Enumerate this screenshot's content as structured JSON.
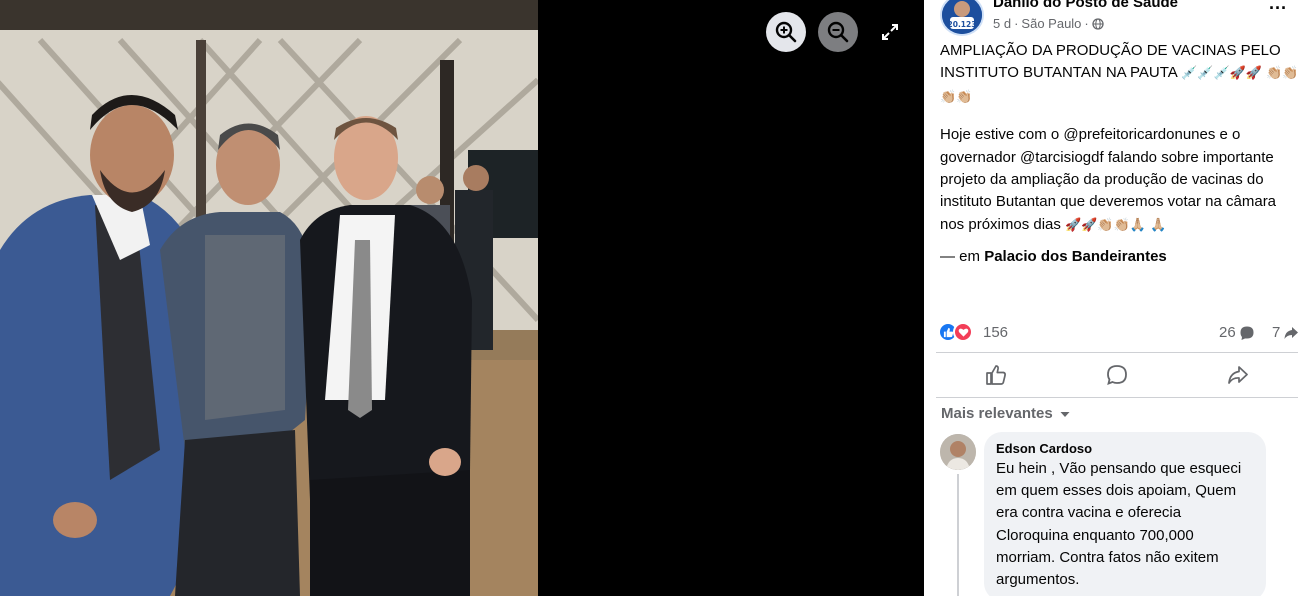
{
  "viewer": {
    "zoom_in_icon": "zoom-in-icon",
    "zoom_out_icon": "zoom-out-icon",
    "fullscreen_icon": "fullscreen-icon"
  },
  "post": {
    "author": "Danilo do Posto de Saúde",
    "time": "5 d",
    "separator": "·",
    "location": "São Paulo",
    "privacy_icon": "globe-icon",
    "more_icon": "more-options-icon",
    "title_text": "AMPLIAÇÃO DA PRODUÇÃO DE VACINAS PELO INSTITUTO BUTANTAN NA PAUTA",
    "title_emojis": "💉💉💉🚀🚀 👏🏼👏🏼👏🏼👏🏼",
    "body_text": "Hoje estive com o @prefeitoricardonunes e o governador @tarcisiogdf falando sobre importante projeto da ampliação da produção de vacinas do instituto Butantan que deveremos votar na câmara nos próximos dias",
    "body_emojis": "🚀🚀👏🏼👏🏼🙏🏼 🙏🏼",
    "at_prefix": "— em",
    "at_place": "Palacio dos Bandeirantes",
    "avatar_badge": "20.123"
  },
  "reactions": {
    "count": "156",
    "comments": "26",
    "shares": "7",
    "like_icon": "like-reaction-icon",
    "love_icon": "love-reaction-icon"
  },
  "actions": {
    "like_icon": "thumbs-up-icon",
    "comment_icon": "comment-icon",
    "share_icon": "share-icon"
  },
  "comments": {
    "sort_label": "Mais relevantes",
    "items": [
      {
        "name": "Edson Cardoso",
        "text": "Eu hein , Vão pensando que esqueci em quem esses dois apoiam, Quem era contra vacina e oferecia Cloroquina enquanto 700,000 morriam. Contra fatos não exitem argumentos."
      }
    ]
  },
  "colors": {
    "accent": "#1877f2",
    "love": "#f33e58",
    "secondary_text": "#65676b",
    "bubble": "#f0f2f5"
  }
}
